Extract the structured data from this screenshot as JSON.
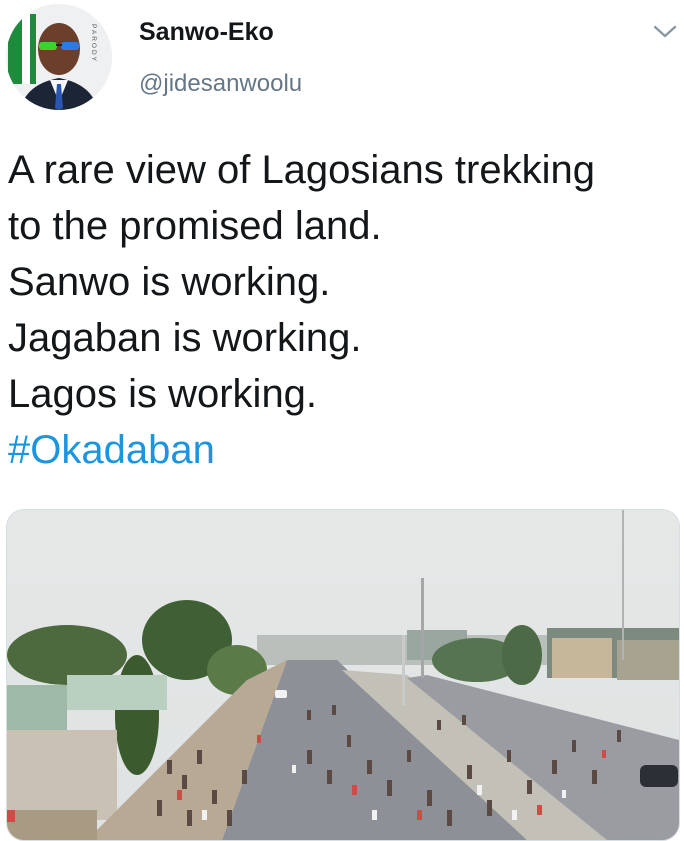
{
  "tweet": {
    "author": {
      "display_name": "Sanwo-Eko",
      "handle": "@jidesanwoolu",
      "avatar_badge": "PARODY",
      "avatar_icon": "avatar"
    },
    "menu_icon": "chevron-down-icon",
    "text_lines": [
      "A rare view of Lagosians trekking",
      "to the promised land.",
      "Sanwo is working.",
      "Jagaban is working.",
      "Lagos is working."
    ],
    "hashtag": "#Okadaban",
    "colors": {
      "text": "#14171a",
      "secondary": "#657786",
      "link": "#1b95e0",
      "chevron": "#8899a6"
    },
    "media": {
      "type": "photo",
      "icon": "photo"
    }
  }
}
